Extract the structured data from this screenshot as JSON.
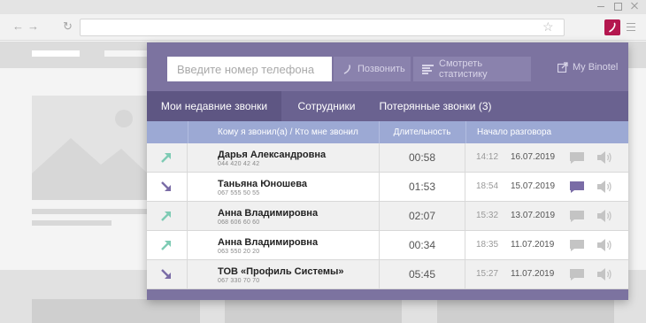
{
  "popup": {
    "phone_placeholder": "Введите номер телефона",
    "call_button": "Позвонить",
    "stats_button": "Смотреть статистику",
    "my_binotel": "My Binotel",
    "tabs": [
      {
        "label": "Мои недавние звонки",
        "active": true
      },
      {
        "label": "Сотрудники",
        "active": false
      },
      {
        "label": "Потерянные звонки (3)",
        "active": false
      }
    ],
    "columns": {
      "who": "Кому я звонил(а) / Кто мне звонил",
      "duration": "Длительность",
      "start": "Начало разговора"
    },
    "calls": [
      {
        "direction": "outgoing",
        "name": "Дарья Александровна",
        "number": "044 420 42 42",
        "duration": "00:58",
        "time": "14:12",
        "date": "16.07.2019",
        "has_comment": false
      },
      {
        "direction": "incoming",
        "name": "Таньяна Юношева",
        "number": "067 555 50 55",
        "duration": "01:53",
        "time": "18:54",
        "date": "15.07.2019",
        "has_comment": true
      },
      {
        "direction": "outgoing",
        "name": "Анна Владимировна",
        "number": "068 606 60 60",
        "duration": "02:07",
        "time": "15:32",
        "date": "13.07.2019",
        "has_comment": false
      },
      {
        "direction": "outgoing",
        "name": "Анна Владимировна",
        "number": "063 550 20 20",
        "duration": "00:34",
        "time": "18:35",
        "date": "11.07.2019",
        "has_comment": false
      },
      {
        "direction": "incoming",
        "name": "ТОВ «Профиль Системы»",
        "number": "067 330 70 70",
        "duration": "05:45",
        "time": "15:27",
        "date": "11.07.2019",
        "has_comment": false
      }
    ]
  },
  "icons": {
    "outgoing": "arrow-up-right-icon",
    "incoming": "arrow-down-right-icon",
    "comment": "comment-icon",
    "record": "speaker-icon"
  },
  "colors": {
    "popup_bg": "#7c73a0",
    "tab_bar": "#6a6290",
    "tab_active": "#5e5683",
    "header_row": "#9ca9d4",
    "outgoing_arrow": "#7ecbb4",
    "incoming_arrow": "#7a6ca6",
    "extension": "#b4174f"
  }
}
